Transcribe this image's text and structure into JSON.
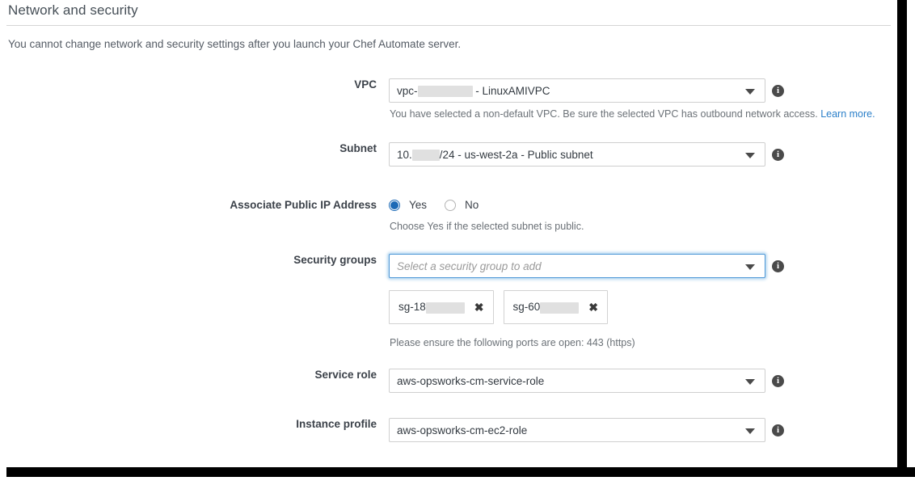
{
  "section": {
    "title": "Network and security",
    "intro": "You cannot change network and security settings after you launch your Chef Automate server."
  },
  "fields": {
    "vpc": {
      "label": "VPC",
      "value_prefix": "vpc-",
      "value_suffix": " - LinuxAMIVPC",
      "redacted": true,
      "help_text": "You have selected a non-default VPC. Be sure the selected VPC has outbound network access. ",
      "help_link": "Learn more.",
      "info_icon": "info-icon"
    },
    "subnet": {
      "label": "Subnet",
      "value_prefix": "10.",
      "value_suffix": "/24 - us-west-2a - Public subnet",
      "redacted": true,
      "info_icon": "info-icon"
    },
    "associate_public_ip": {
      "label": "Associate Public IP Address",
      "options": [
        {
          "label": "Yes",
          "selected": true
        },
        {
          "label": "No",
          "selected": false
        }
      ],
      "help_text": "Choose Yes if the selected subnet is public."
    },
    "security_groups": {
      "label": "Security groups",
      "placeholder": "Select a security group to add",
      "value": "",
      "focused": true,
      "info_icon": "info-icon",
      "tags": [
        {
          "text": "sg-18",
          "redacted": true,
          "remove_icon": "close-icon"
        },
        {
          "text": "sg-60",
          "redacted": true,
          "remove_icon": "close-icon"
        }
      ],
      "help_text": "Please ensure the following ports are open: 443 (https)"
    },
    "service_role": {
      "label": "Service role",
      "value": "aws-opsworks-cm-service-role",
      "info_icon": "info-icon"
    },
    "instance_profile": {
      "label": "Instance profile",
      "value": "aws-opsworks-cm-ec2-role",
      "info_icon": "info-icon"
    }
  },
  "icons": {
    "info": "i",
    "close": "✖",
    "caret": "chevron-down-icon"
  },
  "colors": {
    "accent": "#1b69b6",
    "link": "#2a7fc9",
    "label": "#3c424a",
    "help": "#6b7177",
    "border": "#cfcfcf",
    "focus_border": "#4d97d6",
    "redaction": "#e0e0e0"
  }
}
